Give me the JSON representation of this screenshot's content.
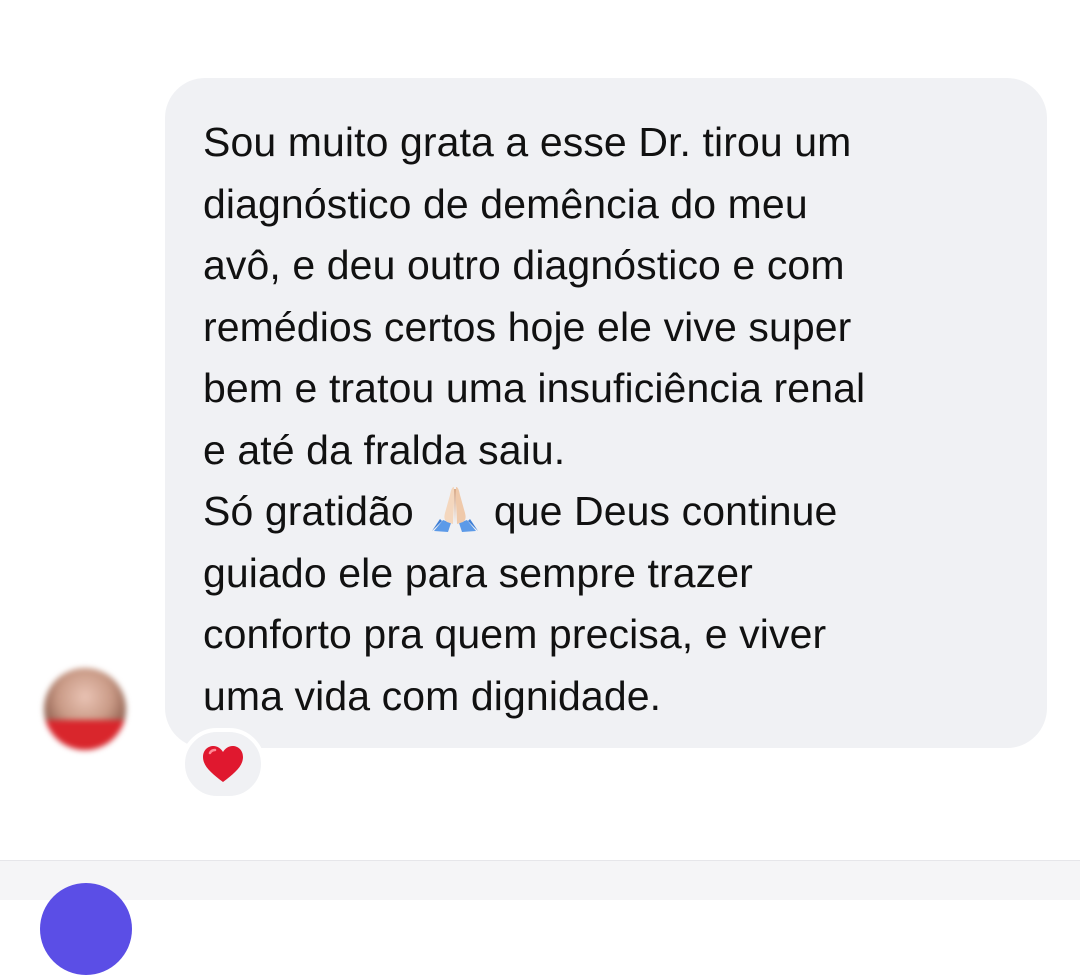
{
  "message": {
    "lines": [
      "Sou muito grata a esse Dr. tirou um",
      "diagnóstico de demência do meu",
      "avô, e deu outro diagnóstico e com",
      "remédios certos hoje ele vive super",
      "bem e tratou uma insuficiência renal",
      "e até da fralda saiu.",
      "Só gratidão",
      "que Deus continue",
      "guiado ele para sempre trazer",
      "conforto pra quem precisa, e viver",
      "uma vida com dignidade."
    ],
    "inline_icon": "folded-hands-icon"
  },
  "reaction": {
    "icon": "heart-icon",
    "color": "#e0182f"
  },
  "colors": {
    "bubble": "#f0f1f4",
    "text": "#111111",
    "composer_avatar": "#5b4ee6"
  }
}
